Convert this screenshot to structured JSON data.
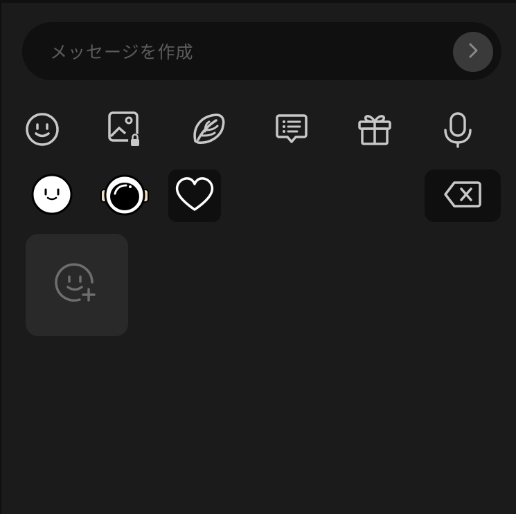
{
  "composer": {
    "placeholder": "メッセージを作成",
    "value": ""
  },
  "toolbar": {
    "icons": [
      {
        "name": "emoji-face-icon"
      },
      {
        "name": "image-locked-icon"
      },
      {
        "name": "leaf-icon"
      },
      {
        "name": "message-list-icon"
      },
      {
        "name": "gift-icon"
      },
      {
        "name": "microphone-icon"
      }
    ]
  },
  "stickers": [
    {
      "name": "white-face-sticker"
    },
    {
      "name": "astronaut-helmet-sticker"
    },
    {
      "name": "heart-sticker",
      "selected": true
    }
  ],
  "colors": {
    "background": "#1b1b1b",
    "composer_bg": "#101010",
    "icon": "#c8c8c8",
    "send_button": "#3a3a3a",
    "add_tile": "#292929"
  }
}
